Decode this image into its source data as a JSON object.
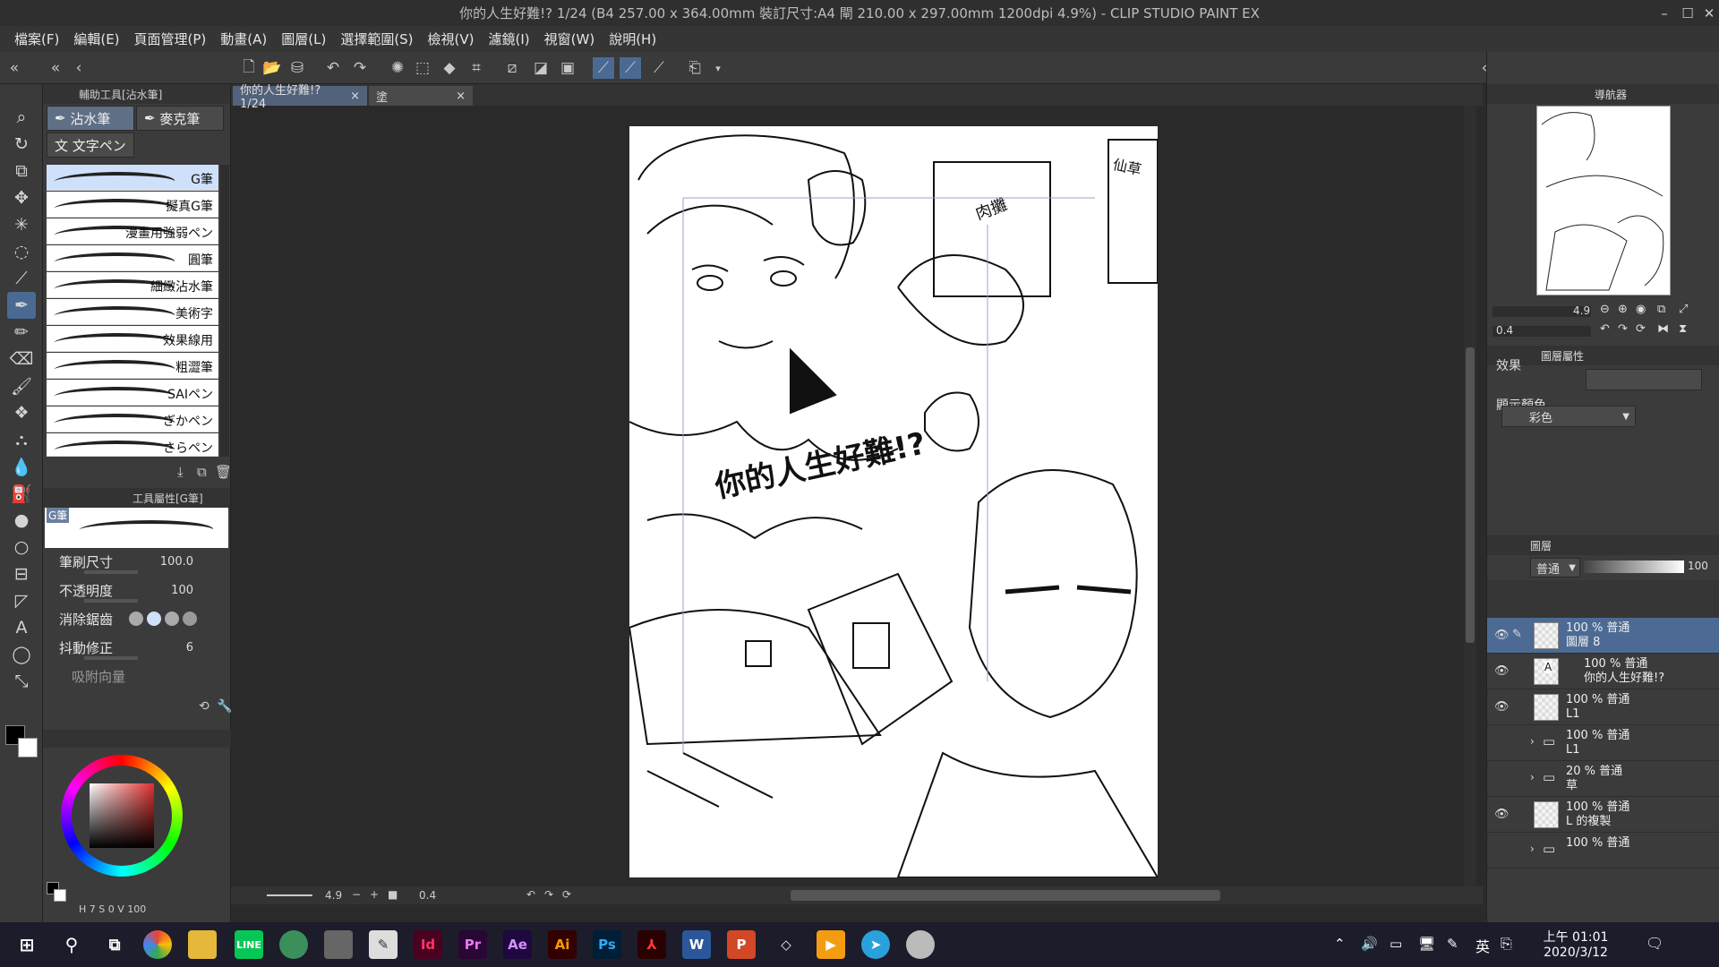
{
  "window": {
    "title": "你的人生好難!? 1/24 (B4 257.00 x 364.00mm 裝訂尺寸:A4 閘 210.00 x 297.00mm 1200dpi 4.9%) - CLIP STUDIO PAINT EX",
    "min_icon": "minimize-icon",
    "max_icon": "maximize-icon",
    "close_icon": "close-icon"
  },
  "menu": [
    "檔案(F)",
    "編輯(E)",
    "頁面管理(P)",
    "動畫(A)",
    "圖層(L)",
    "選擇範圍(S)",
    "檢視(V)",
    "濾鏡(I)",
    "視窗(W)",
    "說明(H)"
  ],
  "subtool": {
    "header": "輔助工具[沾水筆]",
    "groups": [
      "沾水筆",
      "麥克筆",
      "文字ペン"
    ],
    "brushes": [
      "G筆",
      "擬真G筆",
      "漫畫用強弱ペン",
      "圓筆",
      "細緻沾水筆",
      "美術字",
      "效果線用",
      "粗澀筆",
      "SAIペン",
      "ぎかペン",
      "さらペン"
    ]
  },
  "toolprop": {
    "header": "工具屬性[G筆]",
    "preview_label": "G筆",
    "rows": [
      {
        "label": "筆刷尺寸",
        "value": "100.0"
      },
      {
        "label": "不透明度",
        "value": "100"
      },
      {
        "label": "消除鋸齒",
        "value": ""
      },
      {
        "label": "抖動修正",
        "value": "6"
      },
      {
        "label": "吸附向量",
        "value": ""
      }
    ]
  },
  "color": {
    "hsv_h": "7",
    "hsv_s": "0",
    "hsv_v": "100",
    "main": "#000000",
    "sub": "#ffffff"
  },
  "tabs": [
    {
      "label": "你的人生好難!? 1/24"
    },
    {
      "label": "塗"
    }
  ],
  "status": {
    "zoom": "4.9",
    "angle": "0.4"
  },
  "artwork": {
    "title_text": "你的人生好難!?",
    "sign1": "肉攤",
    "sign2": "仙草"
  },
  "navigator": {
    "header": "導航器",
    "zoom": "4.9",
    "angle": "0.4"
  },
  "layer_prop": {
    "header": "圖層屬性",
    "effect_label": "效果",
    "display_color_label": "顯示顏色",
    "display_color_value": "彩色"
  },
  "layers": {
    "header": "圖層",
    "blend": "普通",
    "opacity": "100",
    "items": [
      {
        "mode": "100 % 普通",
        "name": "圖層 8",
        "visible": true,
        "selected": true,
        "type": "raster"
      },
      {
        "mode": "100 % 普通",
        "name": "你的人生好難!?",
        "visible": true,
        "selected": false,
        "type": "text"
      },
      {
        "mode": "100 % 普通",
        "name": "L1",
        "visible": true,
        "selected": false,
        "type": "raster"
      },
      {
        "mode": "100 % 普通",
        "name": "L1",
        "visible": false,
        "selected": false,
        "type": "folder"
      },
      {
        "mode": "20 % 普通",
        "name": "草",
        "visible": false,
        "selected": false,
        "type": "folder"
      },
      {
        "mode": "100 % 普通",
        "name": "L 的複製",
        "visible": true,
        "selected": false,
        "type": "raster"
      },
      {
        "mode": "100 % 普通",
        "name": "",
        "visible": false,
        "selected": false,
        "type": "folder"
      }
    ]
  },
  "taskbar": {
    "apps": [
      "windows-start",
      "search",
      "task-view",
      "chrome",
      "file-explorer",
      "line",
      "maps",
      "clip-studio-alt",
      "clip-studio",
      "indesign",
      "premiere",
      "after-effects",
      "illustrator",
      "photoshop",
      "acrobat",
      "word",
      "powerpoint",
      "unity",
      "media-player",
      "telegram",
      "other"
    ],
    "time": "上午 01:01",
    "date": "2020/3/12",
    "ime": "英"
  }
}
